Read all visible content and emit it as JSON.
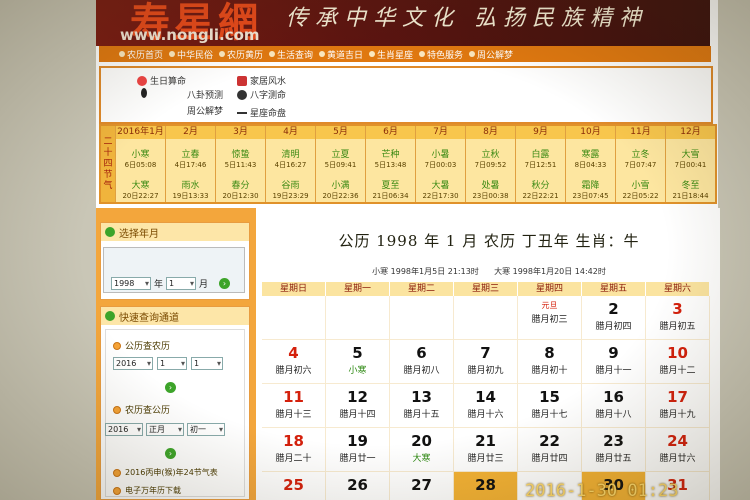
{
  "site": {
    "logo": "寿星網",
    "url": "www.nongli.com",
    "slogan": "传承中华文化 弘扬民族精神"
  },
  "nav": [
    "农历首页",
    "中华民俗",
    "农历黄历",
    "生活查询",
    "黄道吉日",
    "生肖星座",
    "特色服务",
    "周公解梦"
  ],
  "tools": [
    "生日算命",
    "八卦预测",
    "周公解梦",
    "家居风水",
    "八字测命",
    "星座命盘"
  ],
  "terms": {
    "label": "二十四节气",
    "months": [
      {
        "m": "2016年1月",
        "t1": "小寒",
        "d1": "6日05:08",
        "t2": "大寒",
        "d2": "20日22:27"
      },
      {
        "m": "2月",
        "t1": "立春",
        "d1": "4日17:46",
        "t2": "雨水",
        "d2": "19日13:33"
      },
      {
        "m": "3月",
        "t1": "惊蛰",
        "d1": "5日11:43",
        "t2": "春分",
        "d2": "20日12:30"
      },
      {
        "m": "4月",
        "t1": "清明",
        "d1": "4日16:27",
        "t2": "谷雨",
        "d2": "19日23:29"
      },
      {
        "m": "5月",
        "t1": "立夏",
        "d1": "5日09:41",
        "t2": "小满",
        "d2": "20日22:36"
      },
      {
        "m": "6月",
        "t1": "芒种",
        "d1": "5日13:48",
        "t2": "夏至",
        "d2": "21日06:34"
      },
      {
        "m": "7月",
        "t1": "小暑",
        "d1": "7日00:03",
        "t2": "大暑",
        "d2": "22日17:30"
      },
      {
        "m": "8月",
        "t1": "立秋",
        "d1": "7日09:52",
        "t2": "处暑",
        "d2": "23日00:38"
      },
      {
        "m": "9月",
        "t1": "白露",
        "d1": "7日12:51",
        "t2": "秋分",
        "d2": "22日22:21"
      },
      {
        "m": "10月",
        "t1": "寒露",
        "d1": "8日04:33",
        "t2": "霜降",
        "d2": "23日07:45"
      },
      {
        "m": "11月",
        "t1": "立冬",
        "d1": "7日07:47",
        "t2": "小雪",
        "d2": "22日05:22"
      },
      {
        "m": "12月",
        "t1": "大雪",
        "d1": "7日00:41",
        "t2": "冬至",
        "d2": "21日18:44"
      }
    ]
  },
  "sidebar": {
    "select_title": "选择年月",
    "year_value": "1998",
    "year_label": "年",
    "month_value": "1",
    "month_label": "月",
    "quick_title": "快速查询通道",
    "q1_label": "公历查农历",
    "q1_year": "2016",
    "q1_month": "1",
    "q1_day": "1",
    "q2_label": "农历查公历",
    "q2_year": "2016",
    "q2_month": "正月",
    "q2_day": "初一",
    "link1": "2016丙申(猴)年24节气表",
    "link2": "电子万年历下载"
  },
  "calendar": {
    "title": "公历 1998 年 1 月   农历  丁丑年  生肖：牛",
    "sub1": "小寒 1998年1月5日 21:13时",
    "sub2": "大寒 1998年1月20日 14:42时",
    "weekdays": [
      "星期日",
      "星期一",
      "星期二",
      "星期三",
      "星期四",
      "星期五",
      "星期六"
    ]
  },
  "days": [
    [
      null,
      null,
      null,
      null,
      {
        "n": "",
        "l": "腊月初三",
        "top": "元旦"
      },
      {
        "n": "2",
        "l": "腊月初四"
      },
      {
        "n": "3",
        "l": "腊月初五",
        "red": true
      }
    ],
    [
      {
        "n": "4",
        "l": "腊月初六",
        "red": true
      },
      {
        "n": "5",
        "l": "小寒",
        "green": true
      },
      {
        "n": "6",
        "l": "腊月初八"
      },
      {
        "n": "7",
        "l": "腊月初九"
      },
      {
        "n": "8",
        "l": "腊月初十"
      },
      {
        "n": "9",
        "l": "腊月十一"
      },
      {
        "n": "10",
        "l": "腊月十二",
        "red": true
      }
    ],
    [
      {
        "n": "11",
        "l": "腊月十三",
        "red": true
      },
      {
        "n": "12",
        "l": "腊月十四"
      },
      {
        "n": "13",
        "l": "腊月十五"
      },
      {
        "n": "14",
        "l": "腊月十六"
      },
      {
        "n": "15",
        "l": "腊月十七"
      },
      {
        "n": "16",
        "l": "腊月十八"
      },
      {
        "n": "17",
        "l": "腊月十九",
        "red": true
      }
    ],
    [
      {
        "n": "18",
        "l": "腊月二十",
        "red": true
      },
      {
        "n": "19",
        "l": "腊月廿一"
      },
      {
        "n": "20",
        "l": "大寒",
        "green": true
      },
      {
        "n": "21",
        "l": "腊月廿三"
      },
      {
        "n": "22",
        "l": "腊月廿四"
      },
      {
        "n": "23",
        "l": "腊月廿五"
      },
      {
        "n": "24",
        "l": "腊月廿六",
        "red": true
      }
    ],
    [
      {
        "n": "25",
        "l": "",
        "red": true
      },
      {
        "n": "26",
        "l": ""
      },
      {
        "n": "27",
        "l": ""
      },
      {
        "n": "28",
        "l": "",
        "hl": true
      },
      {
        "n": "",
        "l": ""
      },
      {
        "n": "30",
        "l": "",
        "hl": true
      },
      {
        "n": "31",
        "l": "",
        "red": true
      }
    ]
  ],
  "photo_timestamp": "2016-1-30 01:23"
}
